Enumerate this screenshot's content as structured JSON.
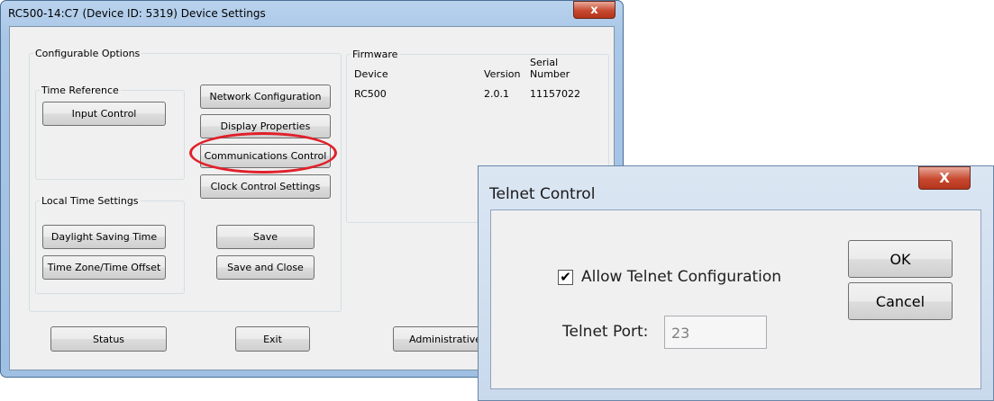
{
  "main_dialog": {
    "title": "RC500-14:C7 (Device ID: 5319) Device Settings",
    "close_glyph": "x",
    "configurable_options": {
      "legend": "Configurable Options",
      "time_reference": {
        "legend": "Time Reference",
        "input_control": "Input Control"
      },
      "local_time_settings": {
        "legend": "Local Time Settings",
        "daylight_saving": "Daylight Saving Time",
        "time_zone": "Time Zone/Time Offset"
      },
      "network_configuration": "Network Configuration",
      "display_properties": "Display Properties",
      "communications_control": "Communications Control",
      "clock_control_settings": "Clock Control Settings",
      "save": "Save",
      "save_and_close": "Save and Close"
    },
    "firmware": {
      "legend": "Firmware",
      "headers": {
        "device": "Device",
        "version": "Version",
        "serial_line1": "Serial",
        "serial_line2": "Number"
      },
      "rows": [
        {
          "device": "RC500",
          "version": "2.0.1",
          "serial": "11157022"
        }
      ]
    },
    "bottom_buttons": {
      "status": "Status",
      "exit": "Exit",
      "administrative": "Administrative Fu"
    },
    "highlight_color": "#e0202a"
  },
  "telnet_dialog": {
    "title": "Telnet Control",
    "close_glyph": "X",
    "allow_telnet_label": "Allow Telnet Configuration",
    "allow_telnet_checked": true,
    "check_glyph": "✔",
    "telnet_port_label": "Telnet Port:",
    "telnet_port_value": "23",
    "ok": "OK",
    "cancel": "Cancel"
  }
}
